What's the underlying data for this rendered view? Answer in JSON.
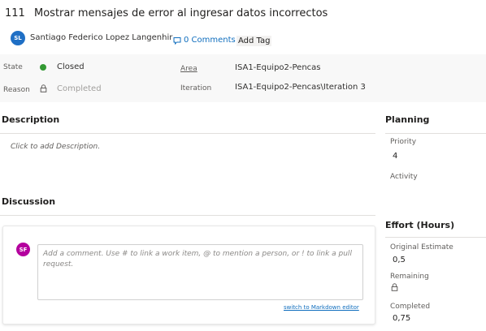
{
  "work_item": {
    "id": "111",
    "title": "Mostrar mensajes de error al ingresar datos incorrectos",
    "owner_initials": "SL",
    "owner_name": "Santiago Federico Lopez Langenhir",
    "comments_label": "0 Comments",
    "add_tag_label": "Add Tag"
  },
  "fields": {
    "state_label": "State",
    "state_value": "Closed",
    "state_color": "#339933",
    "reason_label": "Reason",
    "reason_value": "Completed",
    "area_label": "Area",
    "area_value": "ISA1-Equipo2-Pencas",
    "iteration_label": "Iteration",
    "iteration_value": "ISA1-Equipo2-Pencas\\Iteration 3"
  },
  "description": {
    "title": "Description",
    "placeholder": "Click to add Description."
  },
  "discussion": {
    "title": "Discussion",
    "avatar_initials": "SF",
    "comment_placeholder": "Add a comment. Use # to link a work item, @ to mention a person, or ! to link a pull request.",
    "markdown_link": "switch to Markdown editor"
  },
  "planning": {
    "title": "Planning",
    "priority_label": "Priority",
    "priority_value": "4",
    "activity_label": "Activity",
    "activity_value": ""
  },
  "effort": {
    "title": "Effort (Hours)",
    "original_estimate_label": "Original Estimate",
    "original_estimate_value": "0,5",
    "remaining_label": "Remaining",
    "completed_label": "Completed",
    "completed_value": "0,75"
  },
  "icons": {
    "comment": "comment-icon",
    "lock": "lock-icon",
    "state": "state-dot-icon"
  }
}
